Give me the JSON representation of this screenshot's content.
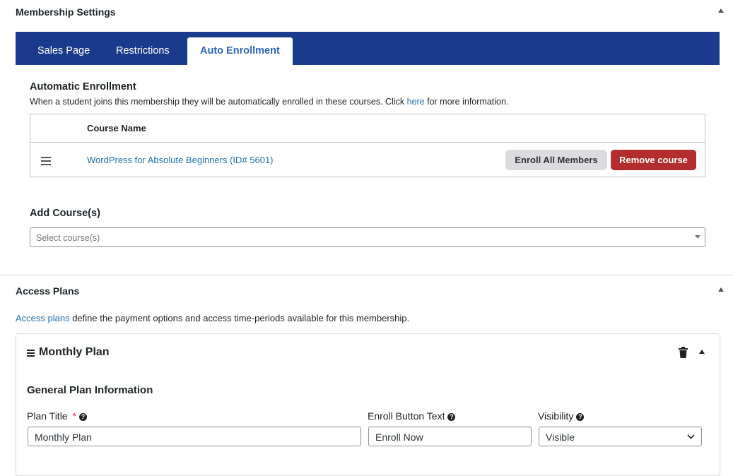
{
  "membership_settings": {
    "title": "Membership Settings",
    "tabs": [
      {
        "label": "Sales Page",
        "active": false
      },
      {
        "label": "Restrictions",
        "active": false
      },
      {
        "label": "Auto Enrollment",
        "active": true
      }
    ],
    "auto_enrollment": {
      "heading": "Automatic Enrollment",
      "description_before": "When a student joins this membership they will be automatically enrolled in these courses. Click ",
      "description_link": "here",
      "description_after": " for more information.",
      "table": {
        "column_header": "Course Name",
        "rows": [
          {
            "course": "WordPress for Absolute Beginners (ID# 5601)",
            "enroll_label": "Enroll All Members",
            "remove_label": "Remove course"
          }
        ]
      },
      "add_courses": {
        "heading": "Add Course(s)",
        "placeholder": "Select course(s)"
      }
    }
  },
  "access_plans": {
    "title": "Access Plans",
    "description_link": "Access plans",
    "description_rest": " define the payment options and access time-periods available for this membership.",
    "plan": {
      "name": "Monthly Plan",
      "section_heading": "General Plan Information",
      "fields": {
        "plan_title_label": "Plan Title",
        "required_mark": "*",
        "plan_title_value": "Monthly Plan",
        "enroll_button_label": "Enroll Button Text",
        "enroll_button_value": "Enroll Now",
        "visibility_label": "Visibility",
        "visibility_value": "Visible"
      }
    }
  },
  "colors": {
    "tab_bar": "#1a3a8c",
    "active_tab_text": "#2e65c0",
    "link": "#2271b1",
    "remove_button": "#b32d2e",
    "enroll_button": "#dcdcde"
  }
}
